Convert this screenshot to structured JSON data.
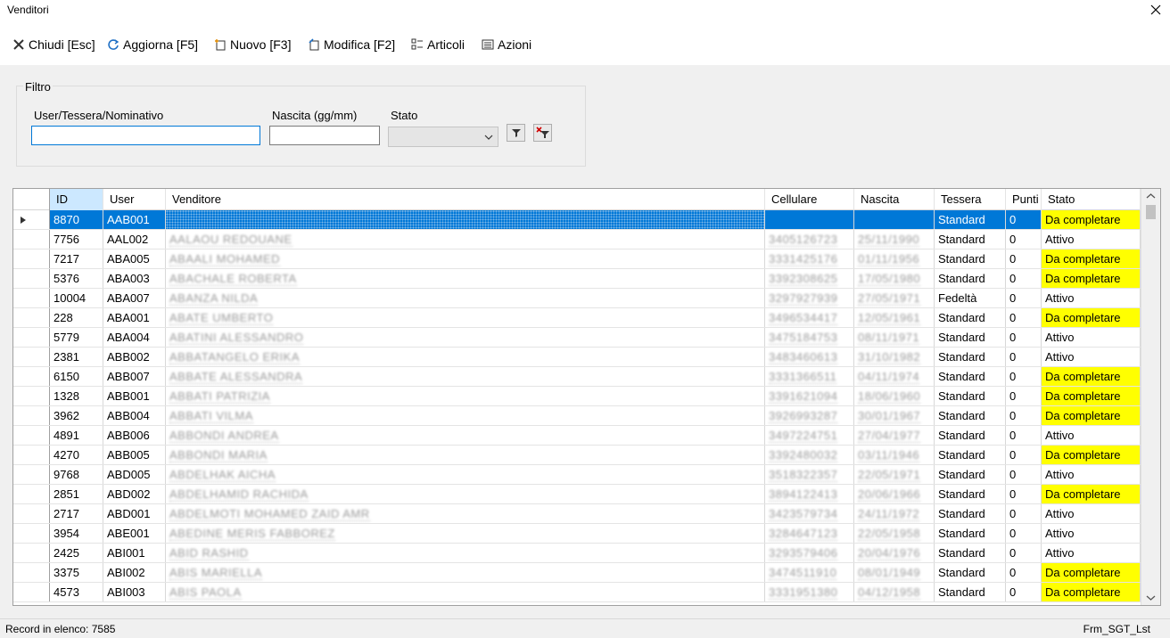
{
  "window": {
    "title": "Venditori"
  },
  "toolbar": {
    "close": "Chiudi [Esc]",
    "refresh": "Aggiorna [F5]",
    "new": "Nuovo [F3]",
    "edit": "Modifica [F2]",
    "articles": "Articoli",
    "actions": "Azioni"
  },
  "filter": {
    "legend": "Filtro",
    "user_label": "User/Tessera/Nominativo",
    "user_value": "",
    "birth_label": "Nascita (gg/mm)",
    "birth_value": "",
    "status_label": "Stato",
    "status_value": ""
  },
  "grid": {
    "columns": [
      "ID",
      "User",
      "Venditore",
      "Cellulare",
      "Nascita",
      "Tessera",
      "Punti",
      "Stato"
    ],
    "rows": [
      {
        "id": "8870",
        "user": "AAB001",
        "name": "",
        "cell": "",
        "birth": "",
        "card": "Standard",
        "points": "0",
        "status": "Da completare"
      },
      {
        "id": "7756",
        "user": "AAL002",
        "name": "AALAOU REDOUANE",
        "cell": "3405126723",
        "birth": "25/11/1990",
        "card": "Standard",
        "points": "0",
        "status": "Attivo"
      },
      {
        "id": "7217",
        "user": "ABA005",
        "name": "ABAALI MOHAMED",
        "cell": "3331425176",
        "birth": "01/11/1956",
        "card": "Standard",
        "points": "0",
        "status": "Da completare"
      },
      {
        "id": "5376",
        "user": "ABA003",
        "name": "ABACHALE ROBERTA",
        "cell": "3392308625",
        "birth": "17/05/1980",
        "card": "Standard",
        "points": "0",
        "status": "Da completare"
      },
      {
        "id": "10004",
        "user": "ABA007",
        "name": "ABANZA NILDA",
        "cell": "3297927939",
        "birth": "27/05/1971",
        "card": "Fedeltà",
        "points": "0",
        "status": "Attivo"
      },
      {
        "id": "228",
        "user": "ABA001",
        "name": "ABATE UMBERTO",
        "cell": "3496534417",
        "birth": "12/05/1961",
        "card": "Standard",
        "points": "0",
        "status": "Da completare"
      },
      {
        "id": "5779",
        "user": "ABA004",
        "name": "ABATINI ALESSANDRO",
        "cell": "3475184753",
        "birth": "08/11/1971",
        "card": "Standard",
        "points": "0",
        "status": "Attivo"
      },
      {
        "id": "2381",
        "user": "ABB002",
        "name": "ABBATANGELO ERIKA",
        "cell": "3483460613",
        "birth": "31/10/1982",
        "card": "Standard",
        "points": "0",
        "status": "Attivo"
      },
      {
        "id": "6150",
        "user": "ABB007",
        "name": "ABBATE ALESSANDRA",
        "cell": "3331366511",
        "birth": "04/11/1974",
        "card": "Standard",
        "points": "0",
        "status": "Da completare"
      },
      {
        "id": "1328",
        "user": "ABB001",
        "name": "ABBATI PATRIZIA",
        "cell": "3391621094",
        "birth": "18/06/1960",
        "card": "Standard",
        "points": "0",
        "status": "Da completare"
      },
      {
        "id": "3962",
        "user": "ABB004",
        "name": "ABBATI VILMA",
        "cell": "3926993287",
        "birth": "30/01/1967",
        "card": "Standard",
        "points": "0",
        "status": "Da completare"
      },
      {
        "id": "4891",
        "user": "ABB006",
        "name": "ABBONDI ANDREA",
        "cell": "3497224751",
        "birth": "27/04/1977",
        "card": "Standard",
        "points": "0",
        "status": "Attivo"
      },
      {
        "id": "4270",
        "user": "ABB005",
        "name": "ABBONDI MARIA",
        "cell": "3392480032",
        "birth": "03/11/1946",
        "card": "Standard",
        "points": "0",
        "status": "Da completare"
      },
      {
        "id": "9768",
        "user": "ABD005",
        "name": "ABDELHAK AICHA",
        "cell": "3518322357",
        "birth": "22/05/1971",
        "card": "Standard",
        "points": "0",
        "status": "Attivo"
      },
      {
        "id": "2851",
        "user": "ABD002",
        "name": "ABDELHAMID RACHIDA",
        "cell": "3894122413",
        "birth": "20/06/1966",
        "card": "Standard",
        "points": "0",
        "status": "Da completare"
      },
      {
        "id": "2717",
        "user": "ABD001",
        "name": "ABDELMOTI MOHAMED ZAID AMR",
        "cell": "3423579734",
        "birth": "24/11/1972",
        "card": "Standard",
        "points": "0",
        "status": "Attivo"
      },
      {
        "id": "3954",
        "user": "ABE001",
        "name": "ABEDINE MERIS FABBOREZ",
        "cell": "3284647123",
        "birth": "22/05/1958",
        "card": "Standard",
        "points": "0",
        "status": "Attivo"
      },
      {
        "id": "2425",
        "user": "ABI001",
        "name": "ABID RASHID",
        "cell": "3293579406",
        "birth": "20/04/1976",
        "card": "Standard",
        "points": "0",
        "status": "Attivo"
      },
      {
        "id": "3375",
        "user": "ABI002",
        "name": "ABIS MARIELLA",
        "cell": "3474511910",
        "birth": "08/01/1949",
        "card": "Standard",
        "points": "0",
        "status": "Da completare"
      },
      {
        "id": "4573",
        "user": "ABI003",
        "name": "ABIS PAOLA",
        "cell": "3331951380",
        "birth": "04/12/1958",
        "card": "Standard",
        "points": "0",
        "status": "Da completare"
      }
    ]
  },
  "status_bar": {
    "records": "Record in elenco: 7585",
    "form": "Frm_SGT_Lst"
  },
  "colors": {
    "selection": "#0078d7",
    "highlight": "#ffff00",
    "header_selected": "#cce8ff"
  }
}
